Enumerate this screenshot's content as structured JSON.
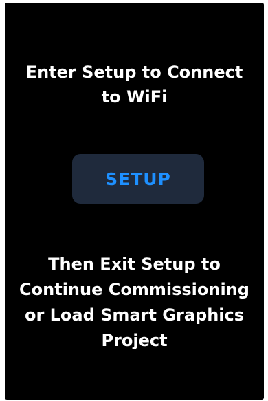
{
  "colors": {
    "background": "#000000",
    "text": "#ffffff",
    "button_background": "#1f2a3c",
    "button_text": "#1e90ff"
  },
  "header": {
    "lines": [
      "Enter Setup to Connect",
      "to WiFi"
    ]
  },
  "setup_button": {
    "label": "SETUP"
  },
  "footer": {
    "lines": [
      "Then Exit Setup to",
      "Continue Commissioning",
      "or Load Smart Graphics",
      "Project"
    ]
  }
}
